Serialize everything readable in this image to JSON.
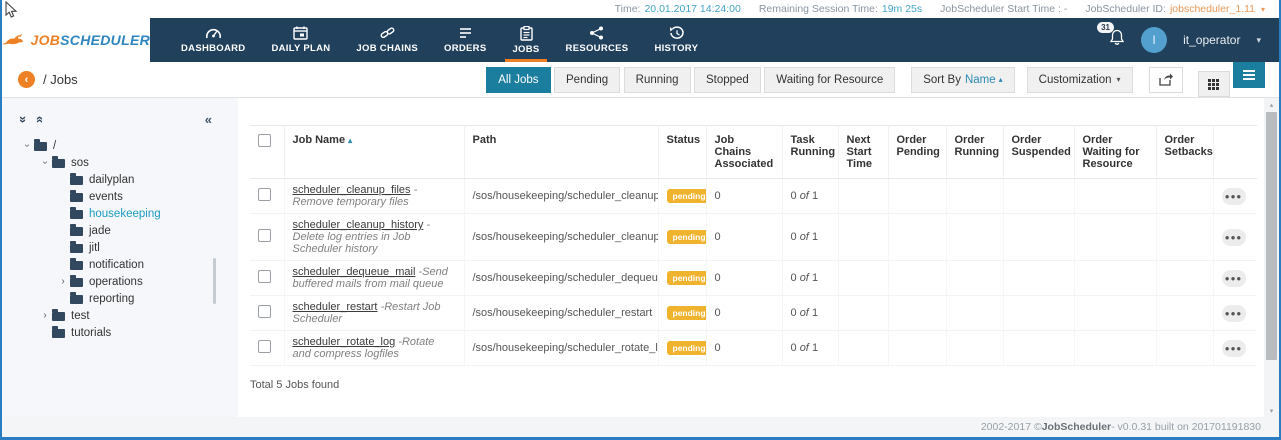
{
  "topbar": {
    "time_label": "Time:",
    "time_value": "20.01.2017 14:24:00",
    "session_label": "Remaining Session Time:",
    "session_value": "19m 25s",
    "start_label": "JobScheduler Start Time : -",
    "id_label": "JobScheduler ID:",
    "id_value": "jobscheduler_1.11"
  },
  "nav": {
    "brand_job": "JOB",
    "brand_scheduler": "SCHEDULER",
    "items": [
      {
        "label": "DASHBOARD",
        "icon": "gauge-icon"
      },
      {
        "label": "DAILY PLAN",
        "icon": "calendar-icon"
      },
      {
        "label": "JOB CHAINS",
        "icon": "chain-icon"
      },
      {
        "label": "ORDERS",
        "icon": "list-lines-icon"
      },
      {
        "label": "JOBS",
        "icon": "clipboard-icon",
        "active": true
      },
      {
        "label": "RESOURCES",
        "icon": "share-icon"
      },
      {
        "label": "HISTORY",
        "icon": "history-icon"
      }
    ],
    "notification_count": "31",
    "avatar_letter": "I",
    "username": "it_operator"
  },
  "breadcrumb": {
    "path": "/ Jobs"
  },
  "filters": {
    "tabs": [
      "All Jobs",
      "Pending",
      "Running",
      "Stopped",
      "Waiting for Resource"
    ],
    "active_tab": "All Jobs",
    "sort_label": "Sort By",
    "sort_value": "Name",
    "customization_label": "Customization"
  },
  "sidebar": {
    "tree": [
      {
        "label": "/",
        "level": 0,
        "expander": "down"
      },
      {
        "label": "sos",
        "level": 1,
        "expander": "down"
      },
      {
        "label": "dailyplan",
        "level": 2,
        "expander": "none"
      },
      {
        "label": "events",
        "level": 2,
        "expander": "none"
      },
      {
        "label": "housekeeping",
        "level": 2,
        "expander": "none",
        "selected": true
      },
      {
        "label": "jade",
        "level": 2,
        "expander": "none"
      },
      {
        "label": "jitl",
        "level": 2,
        "expander": "none"
      },
      {
        "label": "notification",
        "level": 2,
        "expander": "none"
      },
      {
        "label": "operations",
        "level": 2,
        "expander": "right"
      },
      {
        "label": "reporting",
        "level": 2,
        "expander": "none"
      },
      {
        "label": "test",
        "level": 1,
        "expander": "right"
      },
      {
        "label": "tutorials",
        "level": 1,
        "expander": "none"
      }
    ]
  },
  "table": {
    "headers": [
      "Job Name",
      "Path",
      "Status",
      "Job Chains Associated",
      "Task Running",
      "Next Start Time",
      "Order Pending",
      "Order Running",
      "Order Suspended",
      "Order Waiting for Resource",
      "Order Setbacks"
    ],
    "sort_arrow": "▴",
    "rows": [
      {
        "name": "scheduler_cleanup_files",
        "desc": "-Remove temporary files",
        "path": "/sos/housekeeping/scheduler_cleanup_files",
        "status": "pending",
        "job_chains": "0",
        "task_a": "0",
        "task_of": "of",
        "task_b": "1"
      },
      {
        "name": "scheduler_cleanup_history",
        "desc": "-Delete log entries in Job Scheduler history",
        "path": "/sos/housekeeping/scheduler_cleanup_history",
        "status": "pending",
        "job_chains": "0",
        "task_a": "0",
        "task_of": "of",
        "task_b": "1"
      },
      {
        "name": "scheduler_dequeue_mail",
        "desc": "-Send buffered mails from mail queue",
        "path": "/sos/housekeeping/scheduler_dequeue_mail",
        "status": "pending",
        "job_chains": "0",
        "task_a": "0",
        "task_of": "of",
        "task_b": "1"
      },
      {
        "name": "scheduler_restart",
        "desc": "-Restart Job Scheduler",
        "path": "/sos/housekeeping/scheduler_restart",
        "status": "pending",
        "job_chains": "0",
        "task_a": "0",
        "task_of": "of",
        "task_b": "1"
      },
      {
        "name": "scheduler_rotate_log",
        "desc": "-Rotate and compress logfiles",
        "path": "/sos/housekeeping/scheduler_rotate_log",
        "status": "pending",
        "job_chains": "0",
        "task_a": "0",
        "task_of": "of",
        "task_b": "1"
      }
    ],
    "total": "Total 5 Jobs found"
  },
  "footer": {
    "prefix": "2002-2017 © ",
    "brand": "JobScheduler",
    "suffix": "- v0.0.31 built on 201701191830"
  }
}
